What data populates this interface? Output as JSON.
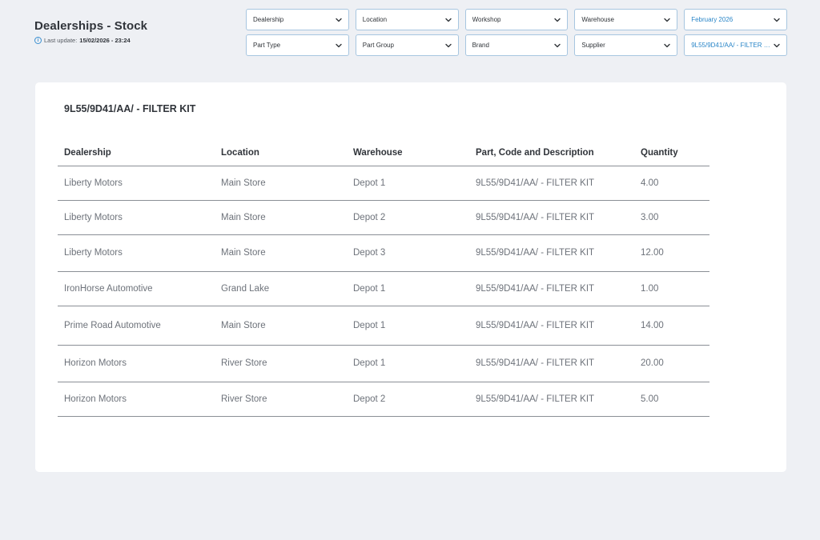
{
  "header": {
    "title": "Dealerships - Stock",
    "last_update_label": "Last update:",
    "last_update_value": "15/02/2026 - 23:24"
  },
  "filters": {
    "row1": [
      "Dealership",
      "Location",
      "Workshop",
      "Warehouse",
      "February 2026"
    ],
    "row2": [
      "Part Type",
      "Part Group",
      "Brand",
      "Supplier",
      "9L55/9D41/AA/ - FILTER KIT"
    ]
  },
  "card": {
    "title": "9L55/9D41/AA/ - FILTER KIT"
  },
  "table": {
    "columns": [
      "Dealership",
      "Location",
      "Warehouse",
      "Part, Code and Description",
      "Quantity"
    ],
    "rows": [
      [
        "Liberty Motors",
        "Main Store",
        "Depot 1",
        "9L55/9D41/AA/ - FILTER KIT",
        "4.00"
      ],
      [
        "Liberty Motors",
        "Main Store",
        "Depot 2",
        "9L55/9D41/AA/ - FILTER KIT",
        "3.00"
      ],
      [
        "Liberty Motors",
        "Main Store",
        "Depot 3",
        "9L55/9D41/AA/ - FILTER KIT",
        "12.00"
      ],
      [
        "IronHorse Automotive",
        "Grand Lake",
        "Depot 1",
        "9L55/9D41/AA/ - FILTER KIT",
        "1.00"
      ],
      [
        "Prime Road Automotive",
        "Main Store",
        "Depot 1",
        "9L55/9D41/AA/ - FILTER KIT",
        "14.00"
      ],
      [
        "Horizon Motors",
        "River Store",
        "Depot 1",
        "9L55/9D41/AA/ - FILTER KIT",
        "20.00"
      ],
      [
        "Horizon Motors",
        "River Store",
        "Depot 2",
        "9L55/9D41/AA/ - FILTER KIT",
        "5.00"
      ]
    ]
  },
  "icons": {
    "filter_chevron": "chevron-down-icon",
    "last_update": "info-icon"
  },
  "colors": {
    "background": "#eef0f4",
    "accent": "#2a86c8",
    "filter_border": "#a7c6e0"
  }
}
